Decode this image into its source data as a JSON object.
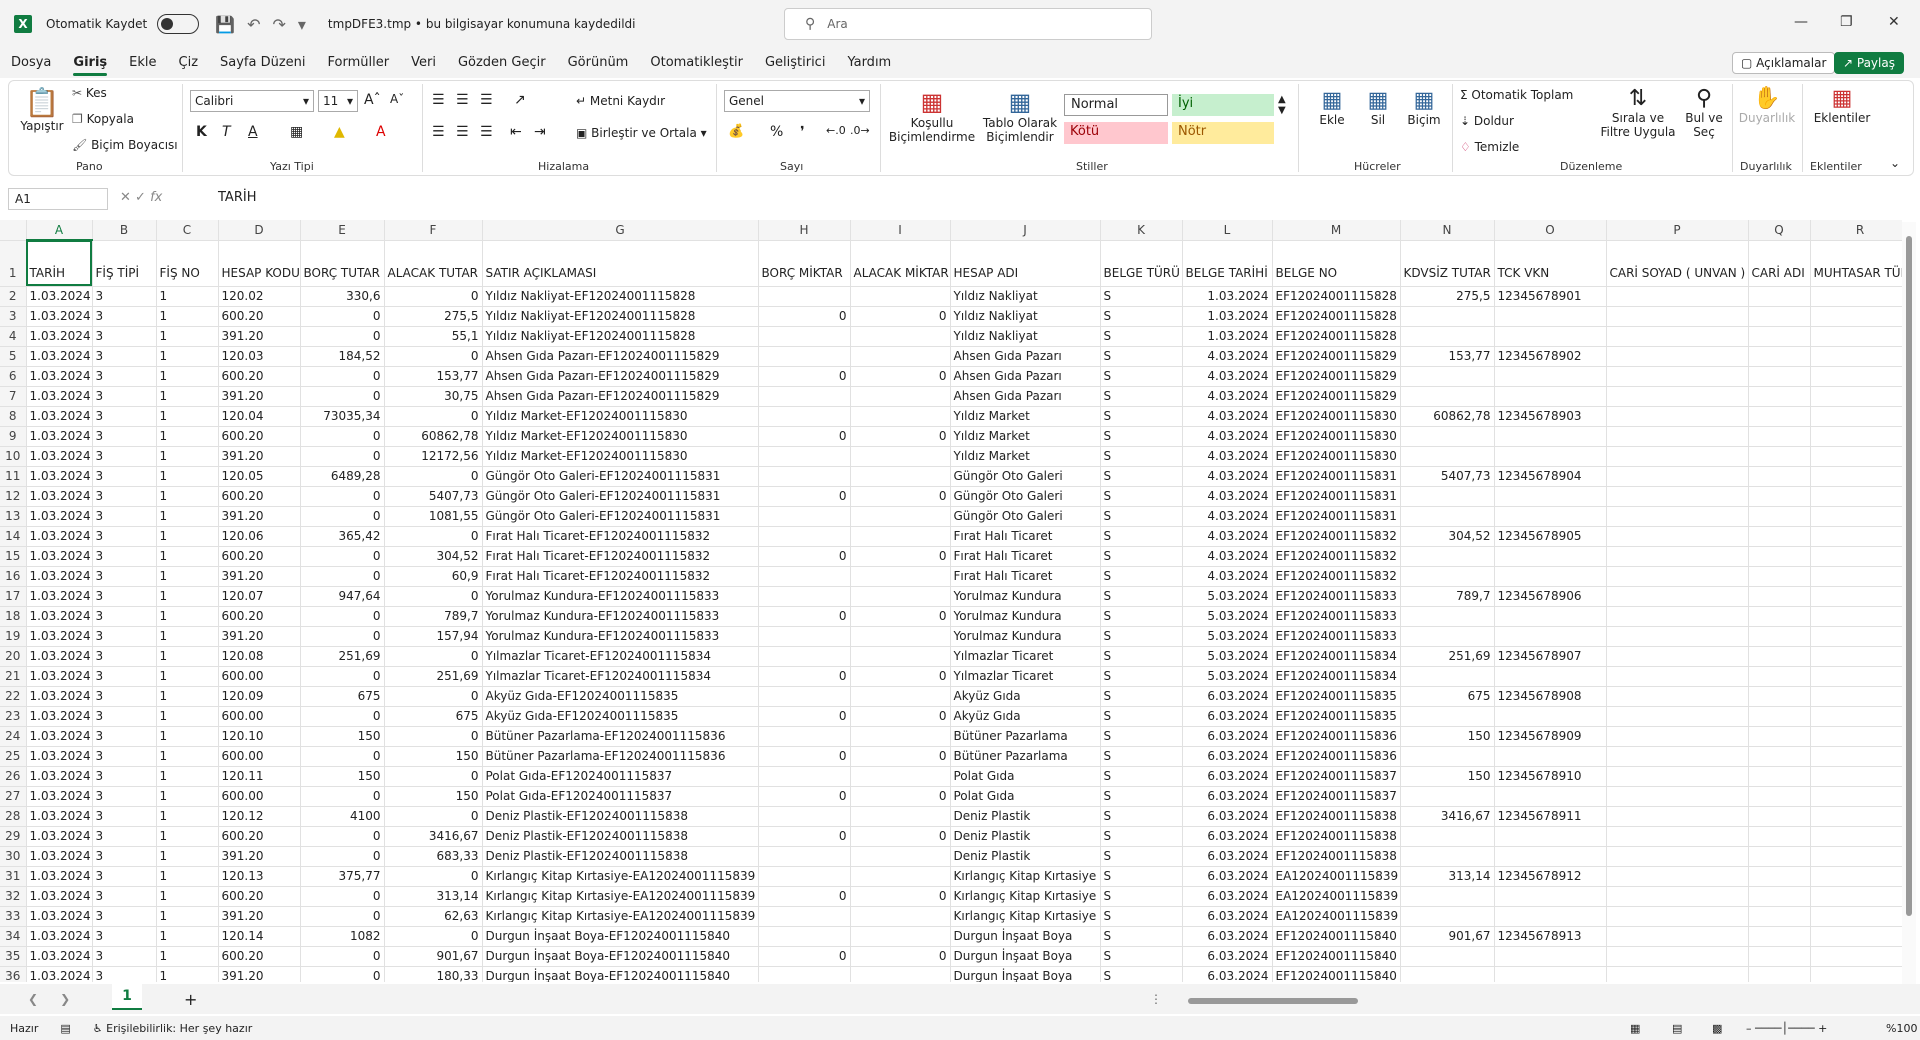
{
  "titlebar": {
    "autosave": "Otomatik Kaydet",
    "filename": "tmpDFE3.tmp • bu bilgisayar konumuna kaydedildi",
    "search_placeholder": "Ara"
  },
  "menus": [
    "Dosya",
    "Giriş",
    "Ekle",
    "Çiz",
    "Sayfa Düzeni",
    "Formüller",
    "Veri",
    "Gözden Geçir",
    "Görünüm",
    "Otomatikleştir",
    "Geliştirici",
    "Yardım"
  ],
  "header_buttons": {
    "comments": "Açıklamalar",
    "share": "Paylaş"
  },
  "ribbon": {
    "clipboard": {
      "paste": "Yapıştır",
      "cut": "Kes",
      "copy": "Kopyala",
      "format_painter": "Biçim Boyacısı",
      "label": "Pano"
    },
    "font": {
      "name": "Calibri",
      "size": "11",
      "label": "Yazı Tipi"
    },
    "alignment": {
      "wrap": "Metni Kaydır",
      "merge": "Birleştir ve Ortala",
      "label": "Hizalama"
    },
    "number": {
      "format": "Genel",
      "label": "Sayı"
    },
    "styles": {
      "conditional": "Koşullu Biçimlendirme",
      "table": "Tablo Olarak Biçimlendir",
      "normal": "Normal",
      "good": "İyi",
      "bad": "Kötü",
      "neutral": "Nötr",
      "label": "Stiller"
    },
    "cells": {
      "insert": "Ekle",
      "delete": "Sil",
      "format": "Biçim",
      "label": "Hücreler"
    },
    "editing": {
      "autosum": "Otomatik Toplam",
      "fill": "Doldur",
      "clear": "Temizle",
      "sort": "Sırala ve Filtre Uygula",
      "find": "Bul ve Seç",
      "label": "Düzenleme"
    },
    "sensitivity": {
      "btn": "Duyarlılık",
      "label": "Duyarlılık"
    },
    "addins": {
      "btn": "Eklentiler",
      "label": "Eklentiler"
    }
  },
  "formula": {
    "namebox": "A1",
    "value": "TARİH"
  },
  "columns": [
    "A",
    "B",
    "C",
    "D",
    "E",
    "F",
    "G",
    "H",
    "I",
    "J",
    "K",
    "L",
    "M",
    "N",
    "O",
    "P",
    "Q",
    "R"
  ],
  "headers": [
    "TARİH",
    "FİŞ TİPİ",
    "FİŞ NO",
    "HESAP KODU",
    "BORÇ TUTAR",
    "ALACAK TUTAR",
    "SATIR AÇIKLAMASI",
    "BORÇ MİKTAR",
    "ALACAK MİKTAR",
    "HESAP ADI",
    "BELGE TÜRÜ",
    "BELGE TARİHİ",
    "BELGE NO",
    "KDVSİZ TUTAR",
    "TCK VKN",
    "CARİ SOYAD ( UNVAN )",
    "CARİ ADI",
    "MUHTASAR TÜR"
  ],
  "rows": [
    [
      "1.03.2024",
      "3",
      "1",
      "120.02",
      "330,6",
      "0",
      "Yıldız Nakliyat-EF12024001115828",
      "",
      "",
      "Yıldız Nakliyat",
      "S",
      "1.03.2024",
      "EF12024001115828",
      "275,5",
      "12345678901",
      "",
      "",
      ""
    ],
    [
      "1.03.2024",
      "3",
      "1",
      "600.20",
      "0",
      "275,5",
      "Yıldız Nakliyat-EF12024001115828",
      "0",
      "0",
      "Yıldız Nakliyat",
      "S",
      "1.03.2024",
      "EF12024001115828",
      "",
      "",
      "",
      "",
      ""
    ],
    [
      "1.03.2024",
      "3",
      "1",
      "391.20",
      "0",
      "55,1",
      "Yıldız Nakliyat-EF12024001115828",
      "",
      "",
      "Yıldız Nakliyat",
      "S",
      "1.03.2024",
      "EF12024001115828",
      "",
      "",
      "",
      "",
      ""
    ],
    [
      "1.03.2024",
      "3",
      "1",
      "120.03",
      "184,52",
      "0",
      "Ahsen Gıda Pazarı-EF12024001115829",
      "",
      "",
      "Ahsen Gıda Pazarı",
      "S",
      "4.03.2024",
      "EF12024001115829",
      "153,77",
      "12345678902",
      "",
      "",
      ""
    ],
    [
      "1.03.2024",
      "3",
      "1",
      "600.20",
      "0",
      "153,77",
      "Ahsen Gıda Pazarı-EF12024001115829",
      "0",
      "0",
      "Ahsen Gıda Pazarı",
      "S",
      "4.03.2024",
      "EF12024001115829",
      "",
      "",
      "",
      "",
      ""
    ],
    [
      "1.03.2024",
      "3",
      "1",
      "391.20",
      "0",
      "30,75",
      "Ahsen Gıda Pazarı-EF12024001115829",
      "",
      "",
      "Ahsen Gıda Pazarı",
      "S",
      "4.03.2024",
      "EF12024001115829",
      "",
      "",
      "",
      "",
      ""
    ],
    [
      "1.03.2024",
      "3",
      "1",
      "120.04",
      "73035,34",
      "0",
      "Yıldız Market-EF12024001115830",
      "",
      "",
      "Yıldız Market",
      "S",
      "4.03.2024",
      "EF12024001115830",
      "60862,78",
      "12345678903",
      "",
      "",
      ""
    ],
    [
      "1.03.2024",
      "3",
      "1",
      "600.20",
      "0",
      "60862,78",
      "Yıldız Market-EF12024001115830",
      "0",
      "0",
      "Yıldız Market",
      "S",
      "4.03.2024",
      "EF12024001115830",
      "",
      "",
      "",
      "",
      ""
    ],
    [
      "1.03.2024",
      "3",
      "1",
      "391.20",
      "0",
      "12172,56",
      "Yıldız Market-EF12024001115830",
      "",
      "",
      "Yıldız Market",
      "S",
      "4.03.2024",
      "EF12024001115830",
      "",
      "",
      "",
      "",
      ""
    ],
    [
      "1.03.2024",
      "3",
      "1",
      "120.05",
      "6489,28",
      "0",
      "Güngör Oto Galeri-EF12024001115831",
      "",
      "",
      "Güngör Oto Galeri",
      "S",
      "4.03.2024",
      "EF12024001115831",
      "5407,73",
      "12345678904",
      "",
      "",
      ""
    ],
    [
      "1.03.2024",
      "3",
      "1",
      "600.20",
      "0",
      "5407,73",
      "Güngör Oto Galeri-EF12024001115831",
      "0",
      "0",
      "Güngör Oto Galeri",
      "S",
      "4.03.2024",
      "EF12024001115831",
      "",
      "",
      "",
      "",
      ""
    ],
    [
      "1.03.2024",
      "3",
      "1",
      "391.20",
      "0",
      "1081,55",
      "Güngör Oto Galeri-EF12024001115831",
      "",
      "",
      "Güngör Oto Galeri",
      "S",
      "4.03.2024",
      "EF12024001115831",
      "",
      "",
      "",
      "",
      ""
    ],
    [
      "1.03.2024",
      "3",
      "1",
      "120.06",
      "365,42",
      "0",
      "Fırat Halı Ticaret-EF12024001115832",
      "",
      "",
      "Fırat Halı Ticaret",
      "S",
      "4.03.2024",
      "EF12024001115832",
      "304,52",
      "12345678905",
      "",
      "",
      ""
    ],
    [
      "1.03.2024",
      "3",
      "1",
      "600.20",
      "0",
      "304,52",
      "Fırat Halı Ticaret-EF12024001115832",
      "0",
      "0",
      "Fırat Halı Ticaret",
      "S",
      "4.03.2024",
      "EF12024001115832",
      "",
      "",
      "",
      "",
      ""
    ],
    [
      "1.03.2024",
      "3",
      "1",
      "391.20",
      "0",
      "60,9",
      "Fırat Halı Ticaret-EF12024001115832",
      "",
      "",
      "Fırat Halı Ticaret",
      "S",
      "4.03.2024",
      "EF12024001115832",
      "",
      "",
      "",
      "",
      ""
    ],
    [
      "1.03.2024",
      "3",
      "1",
      "120.07",
      "947,64",
      "0",
      "Yorulmaz Kundura-EF12024001115833",
      "",
      "",
      "Yorulmaz Kundura",
      "S",
      "5.03.2024",
      "EF12024001115833",
      "789,7",
      "12345678906",
      "",
      "",
      ""
    ],
    [
      "1.03.2024",
      "3",
      "1",
      "600.20",
      "0",
      "789,7",
      "Yorulmaz Kundura-EF12024001115833",
      "0",
      "0",
      "Yorulmaz Kundura",
      "S",
      "5.03.2024",
      "EF12024001115833",
      "",
      "",
      "",
      "",
      ""
    ],
    [
      "1.03.2024",
      "3",
      "1",
      "391.20",
      "0",
      "157,94",
      "Yorulmaz Kundura-EF12024001115833",
      "",
      "",
      "Yorulmaz Kundura",
      "S",
      "5.03.2024",
      "EF12024001115833",
      "",
      "",
      "",
      "",
      ""
    ],
    [
      "1.03.2024",
      "3",
      "1",
      "120.08",
      "251,69",
      "0",
      "Yılmazlar Ticaret-EF12024001115834",
      "",
      "",
      "Yılmazlar Ticaret",
      "S",
      "5.03.2024",
      "EF12024001115834",
      "251,69",
      "12345678907",
      "",
      "",
      ""
    ],
    [
      "1.03.2024",
      "3",
      "1",
      "600.00",
      "0",
      "251,69",
      "Yılmazlar Ticaret-EF12024001115834",
      "0",
      "0",
      "Yılmazlar Ticaret",
      "S",
      "5.03.2024",
      "EF12024001115834",
      "",
      "",
      "",
      "",
      ""
    ],
    [
      "1.03.2024",
      "3",
      "1",
      "120.09",
      "675",
      "0",
      "Akyüz Gıda-EF12024001115835",
      "",
      "",
      "Akyüz Gıda",
      "S",
      "6.03.2024",
      "EF12024001115835",
      "675",
      "12345678908",
      "",
      "",
      ""
    ],
    [
      "1.03.2024",
      "3",
      "1",
      "600.00",
      "0",
      "675",
      "Akyüz Gıda-EF12024001115835",
      "0",
      "0",
      "Akyüz Gıda",
      "S",
      "6.03.2024",
      "EF12024001115835",
      "",
      "",
      "",
      "",
      ""
    ],
    [
      "1.03.2024",
      "3",
      "1",
      "120.10",
      "150",
      "0",
      "Bütüner Pazarlama-EF12024001115836",
      "",
      "",
      "Bütüner Pazarlama",
      "S",
      "6.03.2024",
      "EF12024001115836",
      "150",
      "12345678909",
      "",
      "",
      ""
    ],
    [
      "1.03.2024",
      "3",
      "1",
      "600.00",
      "0",
      "150",
      "Bütüner Pazarlama-EF12024001115836",
      "0",
      "0",
      "Bütüner Pazarlama",
      "S",
      "6.03.2024",
      "EF12024001115836",
      "",
      "",
      "",
      "",
      ""
    ],
    [
      "1.03.2024",
      "3",
      "1",
      "120.11",
      "150",
      "0",
      "Polat Gıda-EF12024001115837",
      "",
      "",
      "Polat Gıda",
      "S",
      "6.03.2024",
      "EF12024001115837",
      "150",
      "12345678910",
      "",
      "",
      ""
    ],
    [
      "1.03.2024",
      "3",
      "1",
      "600.00",
      "0",
      "150",
      "Polat Gıda-EF12024001115837",
      "0",
      "0",
      "Polat Gıda",
      "S",
      "6.03.2024",
      "EF12024001115837",
      "",
      "",
      "",
      "",
      ""
    ],
    [
      "1.03.2024",
      "3",
      "1",
      "120.12",
      "4100",
      "0",
      "Deniz Plastik-EF12024001115838",
      "",
      "",
      "Deniz Plastik",
      "S",
      "6.03.2024",
      "EF12024001115838",
      "3416,67",
      "12345678911",
      "",
      "",
      ""
    ],
    [
      "1.03.2024",
      "3",
      "1",
      "600.20",
      "0",
      "3416,67",
      "Deniz Plastik-EF12024001115838",
      "0",
      "0",
      "Deniz Plastik",
      "S",
      "6.03.2024",
      "EF12024001115838",
      "",
      "",
      "",
      "",
      ""
    ],
    [
      "1.03.2024",
      "3",
      "1",
      "391.20",
      "0",
      "683,33",
      "Deniz Plastik-EF12024001115838",
      "",
      "",
      "Deniz Plastik",
      "S",
      "6.03.2024",
      "EF12024001115838",
      "",
      "",
      "",
      "",
      ""
    ],
    [
      "1.03.2024",
      "3",
      "1",
      "120.13",
      "375,77",
      "0",
      "Kırlangıç Kitap Kırtasiye-EA12024001115839",
      "",
      "",
      "Kırlangıç Kitap Kırtasiye",
      "S",
      "6.03.2024",
      "EA12024001115839",
      "313,14",
      "12345678912",
      "",
      "",
      ""
    ],
    [
      "1.03.2024",
      "3",
      "1",
      "600.20",
      "0",
      "313,14",
      "Kırlangıç Kitap Kırtasiye-EA12024001115839",
      "0",
      "0",
      "Kırlangıç Kitap Kırtasiye",
      "S",
      "6.03.2024",
      "EA12024001115839",
      "",
      "",
      "",
      "",
      ""
    ],
    [
      "1.03.2024",
      "3",
      "1",
      "391.20",
      "0",
      "62,63",
      "Kırlangıç Kitap Kırtasiye-EA12024001115839",
      "",
      "",
      "Kırlangıç Kitap Kırtasiye",
      "S",
      "6.03.2024",
      "EA12024001115839",
      "",
      "",
      "",
      "",
      ""
    ],
    [
      "1.03.2024",
      "3",
      "1",
      "120.14",
      "1082",
      "0",
      "Durgun İnşaat Boya-EF12024001115840",
      "",
      "",
      "Durgun İnşaat Boya",
      "S",
      "6.03.2024",
      "EF12024001115840",
      "901,67",
      "12345678913",
      "",
      "",
      ""
    ],
    [
      "1.03.2024",
      "3",
      "1",
      "600.20",
      "0",
      "901,67",
      "Durgun İnşaat Boya-EF12024001115840",
      "0",
      "0",
      "Durgun İnşaat Boya",
      "S",
      "6.03.2024",
      "EF12024001115840",
      "",
      "",
      "",
      "",
      ""
    ],
    [
      "1.03.2024",
      "3",
      "1",
      "391.20",
      "0",
      "180,33",
      "Durgun İnşaat Boya-EF12024001115840",
      "",
      "",
      "Durgun İnşaat Boya",
      "S",
      "6.03.2024",
      "EF12024001115840",
      "",
      "",
      "",
      "",
      ""
    ]
  ],
  "sheet": {
    "tab": "1",
    "add": "+"
  },
  "status": {
    "ready": "Hazır",
    "accessibility": "Erişilebilirlik: Her şey hazır",
    "zoom": "%100"
  },
  "colors": {
    "accent": "#107c41"
  }
}
